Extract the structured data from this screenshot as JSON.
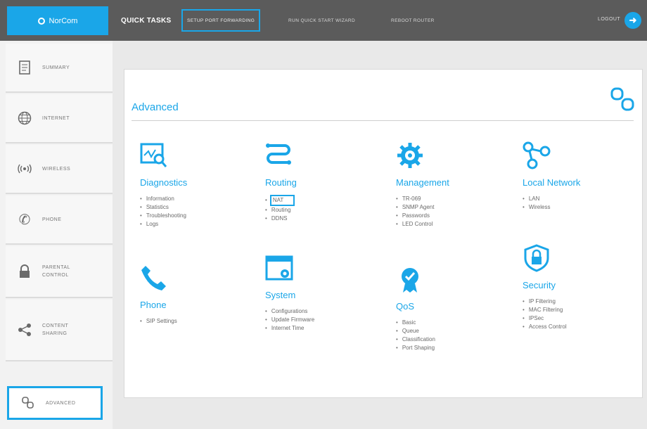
{
  "brand": {
    "name": "NorCom"
  },
  "topbar": {
    "quick_tasks": "QUICK TASKS",
    "nav": [
      "SETUP PORT FORWARDING",
      "RUN QUICK START WIZARD",
      "REBOOT ROUTER"
    ],
    "logout": "LOGOUT"
  },
  "sidebar": {
    "items": [
      {
        "label": "SUMMARY",
        "icon": "document-icon"
      },
      {
        "label": "INTERNET",
        "icon": "globe-icon"
      },
      {
        "label": "WIRELESS",
        "icon": "wireless-icon"
      },
      {
        "label": "PHONE",
        "icon": "phone-icon"
      },
      {
        "label": "PARENTAL CONTROL",
        "icon": "lock-icon"
      },
      {
        "label": "CONTENT SHARING",
        "icon": "share-icon"
      },
      {
        "label": "ADVANCED",
        "icon": "advanced-icon"
      }
    ]
  },
  "main": {
    "title": "Advanced",
    "categories": [
      {
        "title": "Diagnostics",
        "icon": "diagnostics-icon",
        "items": [
          "Information",
          "Statistics",
          "Troubleshooting",
          "Logs"
        ]
      },
      {
        "title": "Routing",
        "icon": "routing-icon",
        "items": [
          "NAT",
          "Routing",
          "DDNS"
        ]
      },
      {
        "title": "Management",
        "icon": "management-icon",
        "items": [
          "TR-069",
          "SNMP Agent",
          "Passwords",
          "LED Control"
        ]
      },
      {
        "title": "Local Network",
        "icon": "network-icon",
        "items": [
          "LAN",
          "Wireless"
        ]
      },
      {
        "title": "Phone",
        "icon": "phone-icon",
        "items": [
          "SIP Settings"
        ]
      },
      {
        "title": "System",
        "icon": "system-icon",
        "items": [
          "Configurations",
          "Update Firmware",
          "Internet Time"
        ]
      },
      {
        "title": "QoS",
        "icon": "qos-icon",
        "items": [
          "Basic",
          "Queue",
          "Classification",
          "Port Shaping"
        ]
      },
      {
        "title": "Security",
        "icon": "security-icon",
        "items": [
          "IP Filtering",
          "MAC Filtering",
          "IPSec",
          "Access Control"
        ]
      }
    ]
  },
  "colors": {
    "accent": "#1aa6e8",
    "topbar": "#5b5b5b"
  }
}
